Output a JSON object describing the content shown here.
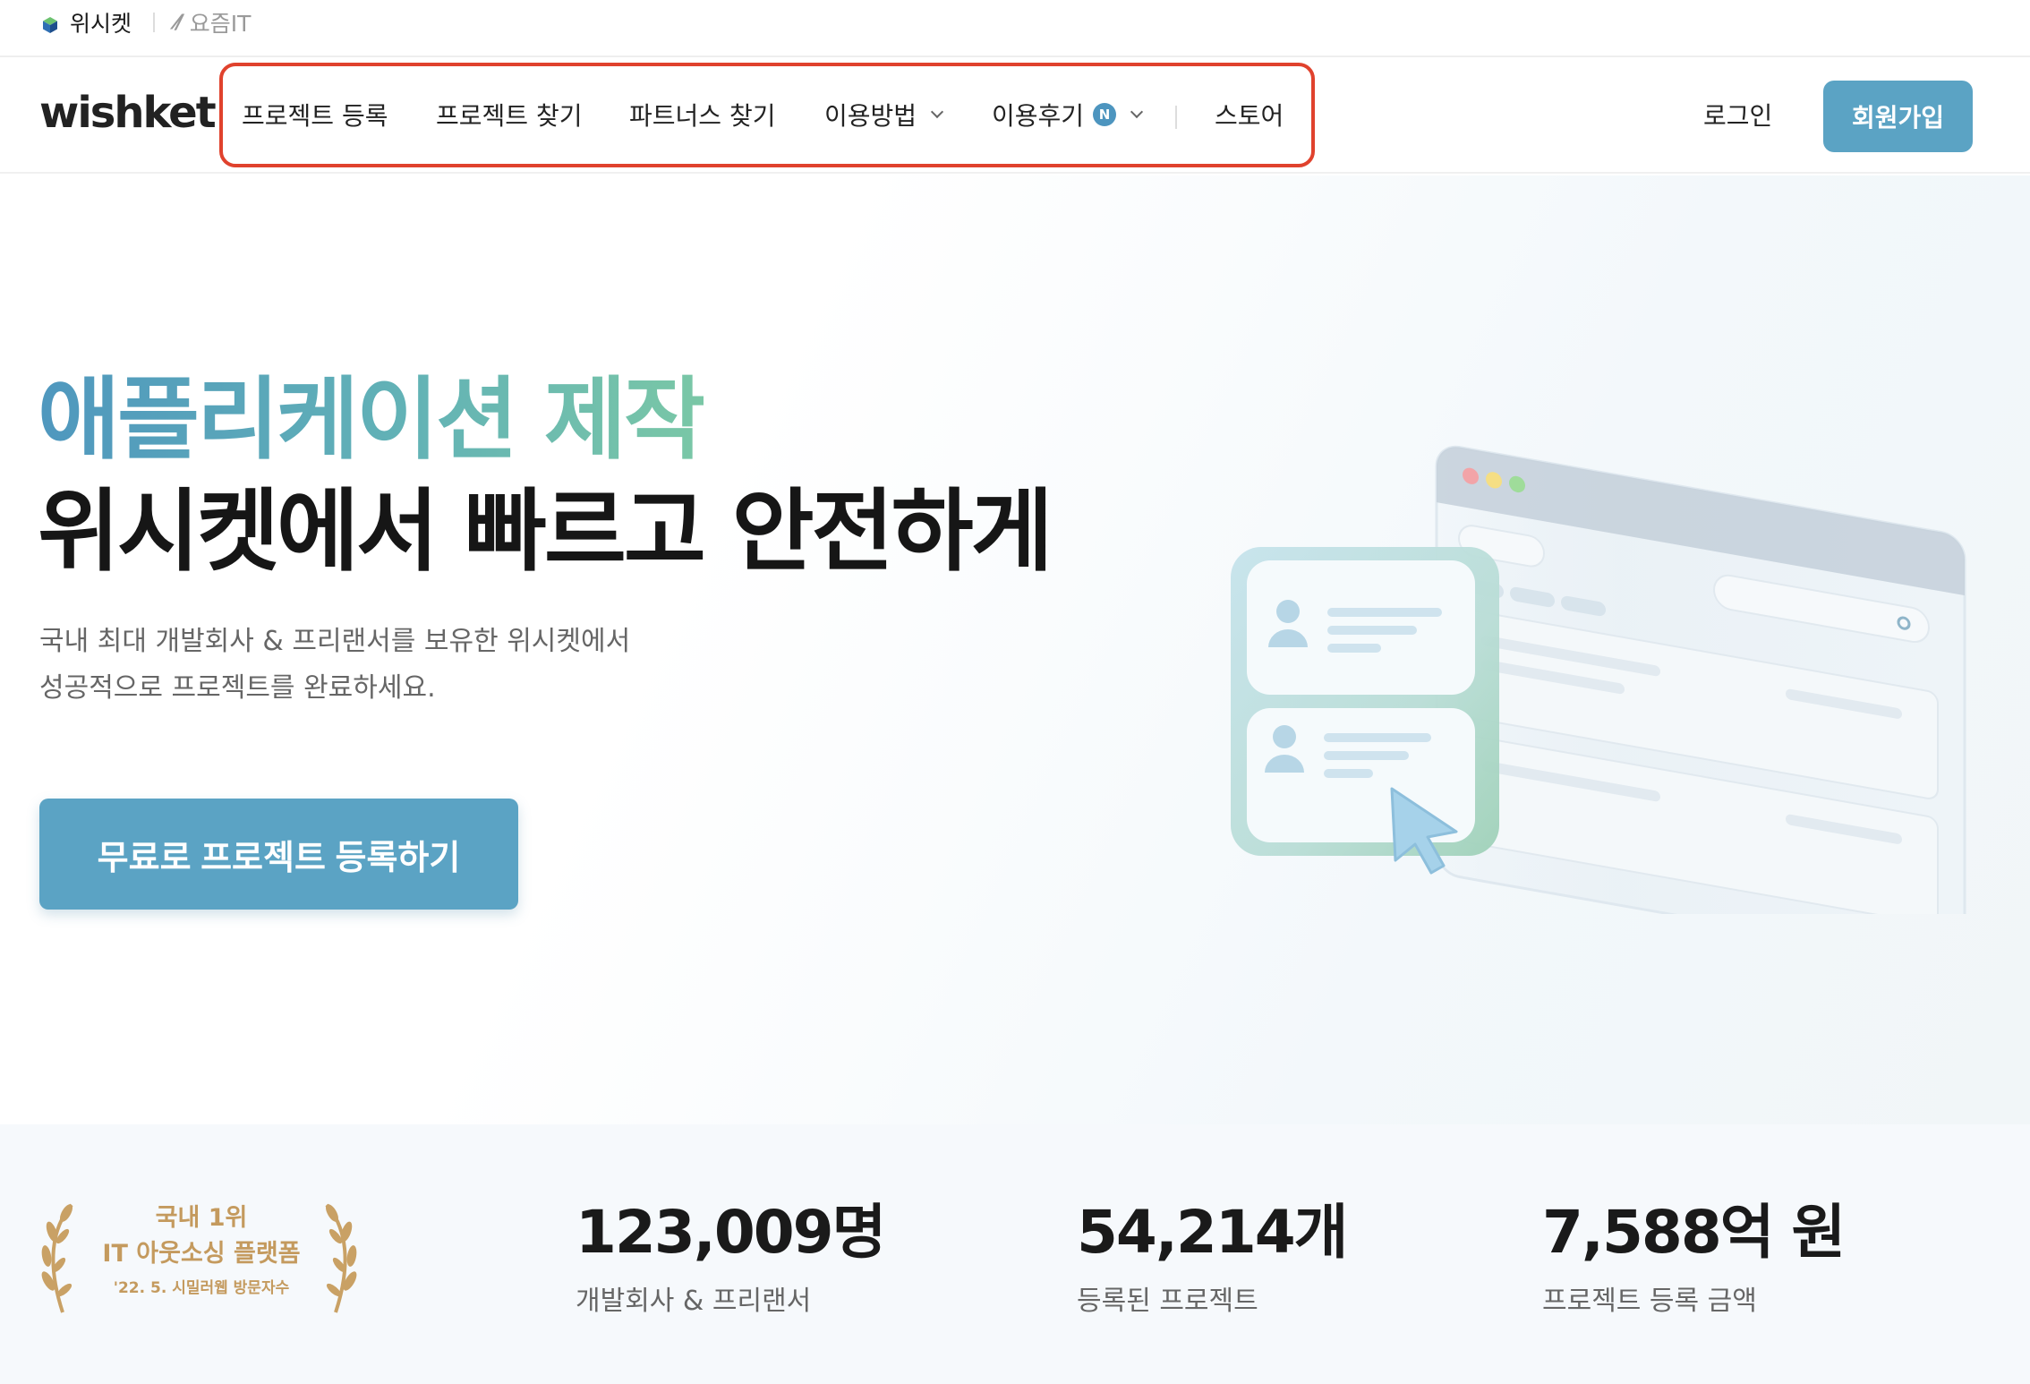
{
  "topbar": {
    "sites": [
      "위시켓",
      "요즘IT"
    ]
  },
  "nav": {
    "logo": "wishket",
    "items": [
      "프로젝트 등록",
      "프로젝트 찾기",
      "파트너스 찾기",
      "이용방법",
      "이용후기",
      "스토어"
    ],
    "new_badge": "N",
    "login": "로그인",
    "signup": "회원가입"
  },
  "hero": {
    "title_line1": "애플리케이션 제작",
    "title_line2": "위시켓에서 빠르고 안전하게",
    "subtitle_line1": "국내 최대 개발회사 & 프리랜서를 보유한 위시켓에서",
    "subtitle_line2": "성공적으로 프로젝트를 완료하세요.",
    "cta": "무료로 프로젝트 등록하기"
  },
  "stats": {
    "award_line1": "국내 1위",
    "award_line2": "IT 아웃소싱 플랫폼",
    "award_line3": "'22. 5. 시밀러웹 방문자수",
    "items": [
      {
        "value": "123,009명",
        "label": "개발회사 & 프리랜서"
      },
      {
        "value": "54,214개",
        "label": "등록된 프로젝트"
      },
      {
        "value": "7,588억 원",
        "label": "프로젝트 등록 금액"
      }
    ]
  },
  "colors": {
    "brand_blue": "#5ba3c4",
    "highlight_red": "#e0422d",
    "award_gold": "#c49a5e",
    "gradient_start": "#4f97be",
    "gradient_end": "#7ac7a6"
  },
  "icons": [
    "wishket-cube-icon",
    "yozmit-logo-icon",
    "chevron-down-icon",
    "laurel-left-icon",
    "laurel-right-icon",
    "search-icon",
    "user-avatar-icon",
    "cursor-arrow-icon"
  ]
}
